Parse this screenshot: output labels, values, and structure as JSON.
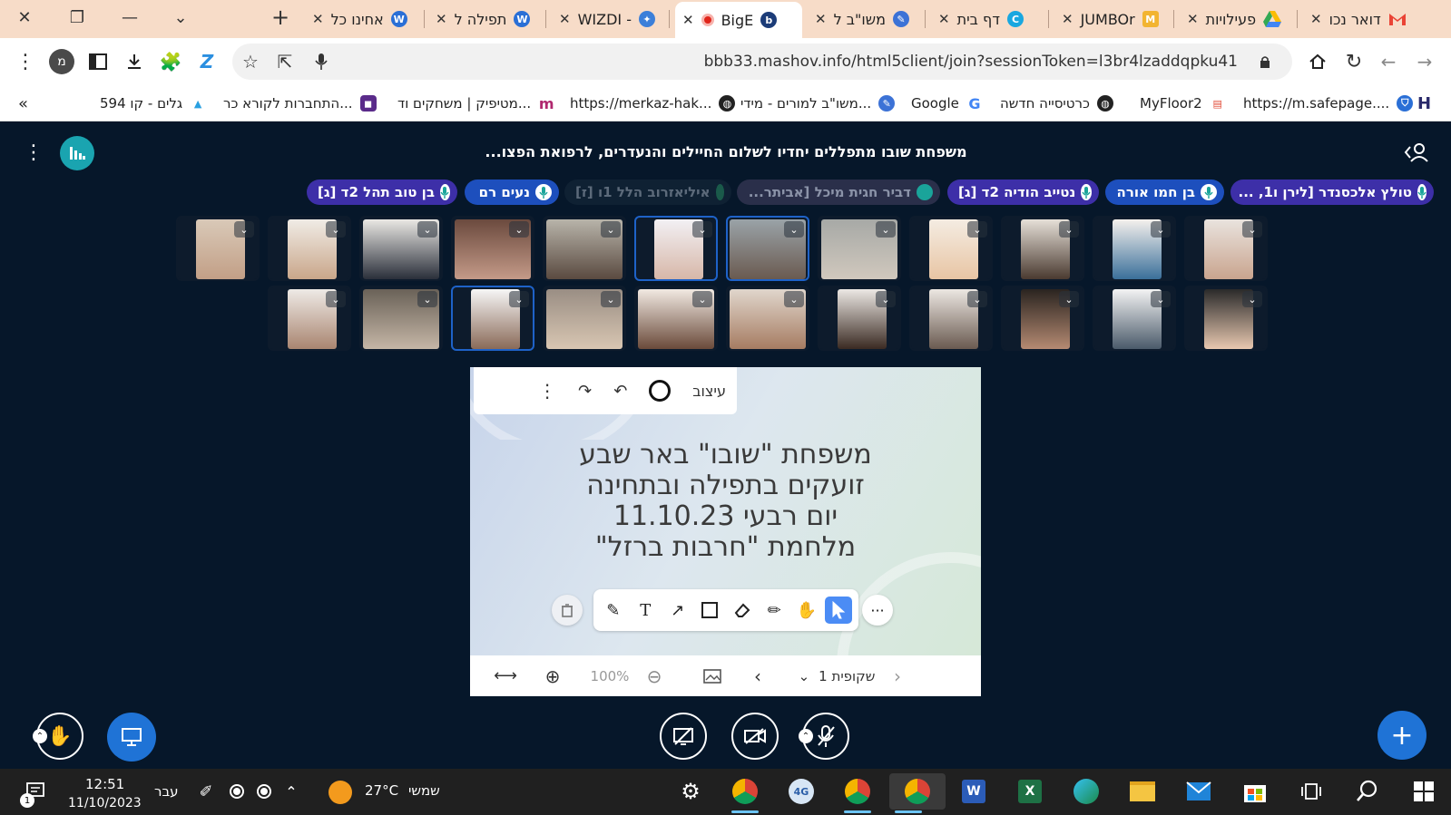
{
  "tabs": [
    {
      "title": "אחינו כל",
      "active": false
    },
    {
      "title": "תפילה ל",
      "active": false
    },
    {
      "title": "WIZDI -",
      "active": false
    },
    {
      "title": "BigE",
      "active": true
    },
    {
      "title": "משו\"ב ל",
      "active": false
    },
    {
      "title": "דף בית",
      "active": false
    },
    {
      "title": "JUMBOr",
      "active": false
    },
    {
      "title": "פעילויות",
      "active": false
    },
    {
      "title": "דואר נכו",
      "active": false
    }
  ],
  "address": {
    "url": "bbb33.mashov.info/html5client/join?sessionToken=l3br4lzaddqpku41",
    "profile_letter": "מ"
  },
  "bookmarks": [
    {
      "label": "https://m.safepage...."
    },
    {
      "label": "MyFloor2"
    },
    {
      "label": "כרטיסייה חדשה"
    },
    {
      "label": "Google"
    },
    {
      "label": "משו\"ב למורים - מידי..."
    },
    {
      "label": "https://merkaz-hak..."
    },
    {
      "label": "מטיפיק | משחקים וד..."
    },
    {
      "label": "התחברות לקורא כר..."
    },
    {
      "label": "גלים - קו 594"
    }
  ],
  "meeting": {
    "title": "משפחת שובו מתפללים יחדיו לשלום החיילים והנעדרים, לרפואת הפצו..."
  },
  "talkers": [
    {
      "name": "טולץ אלכסנדר [לירן ו1, ...",
      "color": "#3d2fa8",
      "muted": false
    },
    {
      "name": "בן חמו אורה",
      "color": "#1d4fbd",
      "muted": false
    },
    {
      "name": "נטייב הודיה 2ד [ג]",
      "color": "#3d2fa8",
      "muted": false
    },
    {
      "name": "דביר חגית מיכל [אביתר...",
      "color": "#2a2f4a",
      "muted": true
    },
    {
      "name": "איליאזרוב הלל 1ו [ז]",
      "color": "#0f2133",
      "muted": true
    },
    {
      "name": "נעים רם",
      "color": "#1d4fbd",
      "muted": false
    },
    {
      "name": "בן טוב תהל 2ד [ג]",
      "color": "#3d2fa8",
      "muted": false
    }
  ],
  "presentation": {
    "style_label": "עיצוב",
    "slide_lines": [
      "משפחת \"שובו\" באר שבע",
      "זועקים בתפילה ובתחינה",
      "יום רבעי 11.10.23",
      "מלחמת \"חרבות ברזל\""
    ],
    "zoom": "100%",
    "slide_label": "שקופית 1"
  },
  "taskbar": {
    "time": "12:51",
    "date": "11/10/2023",
    "lang": "עבר",
    "weather_temp": "27°C",
    "weather_text": "שמשי",
    "notif_count": "1"
  }
}
